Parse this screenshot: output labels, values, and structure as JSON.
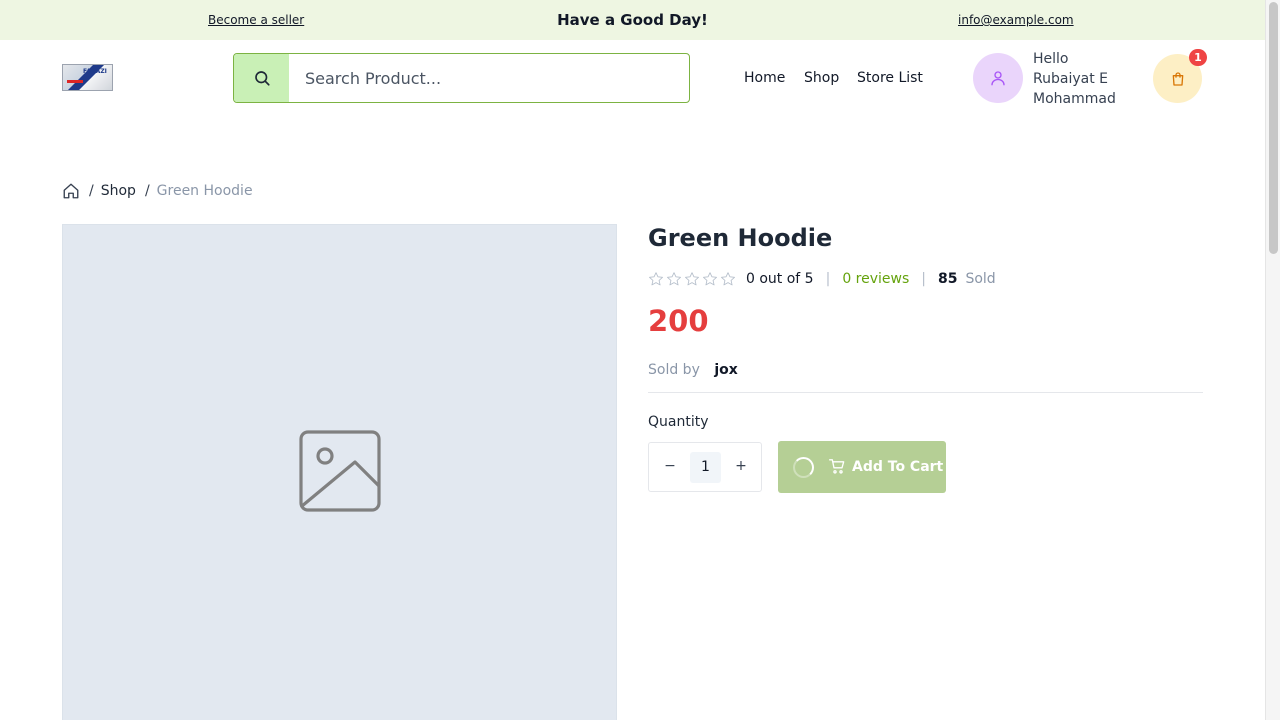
{
  "topbar": {
    "seller_link": "Become a seller",
    "greeting": "Have a Good Day!",
    "email": "info@example.com",
    "background": "#eef6e2"
  },
  "header": {
    "logo_text": "FARAZI",
    "search_placeholder": "Search Product...",
    "nav": [
      "Home",
      "Shop",
      "Store List"
    ],
    "user_greeting": "Hello Rubaiyat E Mohammad",
    "cart_count": "1",
    "accent_color": "#7cb342"
  },
  "breadcrumb": {
    "shop": "Shop",
    "current": "Green Hoodie",
    "separator": "/"
  },
  "product": {
    "title": "Green Hoodie",
    "rating": 0,
    "rating_text": "0 out of 5",
    "reviews": "0 reviews",
    "sold_count": "85",
    "sold_label": "Sold",
    "price": "200",
    "sold_by_label": "Sold by",
    "seller": "jox",
    "quantity_label": "Quantity",
    "quantity": "1",
    "minus": "−",
    "plus": "+",
    "add_to_cart": "Add To Cart",
    "image_icon": "image-placeholder-icon"
  }
}
